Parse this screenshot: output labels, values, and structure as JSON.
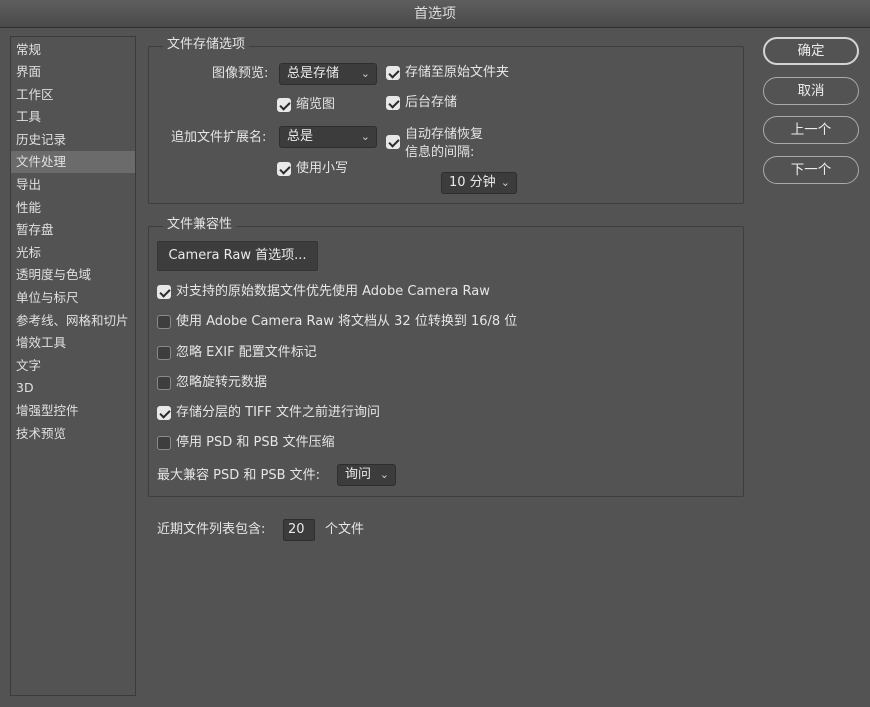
{
  "window": {
    "title": "首选项"
  },
  "sidebar": {
    "selected_index": 5,
    "items": [
      "常规",
      "界面",
      "工作区",
      "工具",
      "历史记录",
      "文件处理",
      "导出",
      "性能",
      "暂存盘",
      "光标",
      "透明度与色域",
      "单位与标尺",
      "参考线、网格和切片",
      "增效工具",
      "文字",
      "3D",
      "增强型控件",
      "技术预览"
    ]
  },
  "file_save": {
    "title": "文件存储选项",
    "image_preview_label": "图像预览:",
    "image_preview_value": "总是存储",
    "thumbnail": {
      "label": "缩览图",
      "checked": true
    },
    "save_to_original": {
      "label": "存储至原始文件夹",
      "checked": true
    },
    "background_save": {
      "label": "后台存储",
      "checked": true
    },
    "append_ext_label": "追加文件扩展名:",
    "append_ext_value": "总是",
    "lowercase": {
      "label": "使用小写",
      "checked": true
    },
    "auto_save": {
      "label_line1": "自动存储恢复",
      "label_line2": "信息的间隔:",
      "checked": true
    },
    "interval_value": "10 分钟"
  },
  "compat": {
    "title": "文件兼容性",
    "camera_raw_button": "Camera Raw 首选项...",
    "options": [
      {
        "label": "对支持的原始数据文件优先使用 Adobe Camera Raw",
        "checked": true
      },
      {
        "label": "使用 Adobe Camera Raw 将文档从 32 位转换到 16/8 位",
        "checked": false
      },
      {
        "label": "忽略 EXIF 配置文件标记",
        "checked": false
      },
      {
        "label": "忽略旋转元数据",
        "checked": false
      },
      {
        "label": "存储分层的 TIFF 文件之前进行询问",
        "checked": true
      },
      {
        "label": "停用 PSD 和 PSB 文件压缩",
        "checked": false
      }
    ],
    "max_compat_label": "最大兼容 PSD 和 PSB 文件:",
    "max_compat_value": "询问"
  },
  "recent": {
    "label": "近期文件列表包含:",
    "value": "20",
    "suffix": "个文件"
  },
  "buttons": {
    "ok": "确定",
    "cancel": "取消",
    "prev": "上一个",
    "next": "下一个"
  },
  "icons": {
    "dropdown": "chevron-down-icon",
    "check": "checkmark-icon"
  },
  "colors": {
    "background": "#535353",
    "selected_item": "#6b6b6b"
  }
}
